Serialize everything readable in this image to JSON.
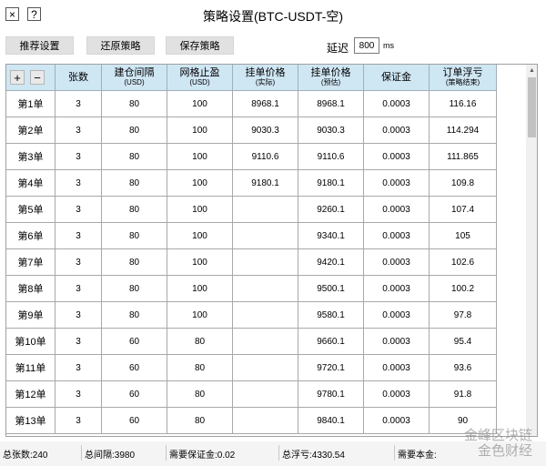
{
  "window": {
    "title": "策略设置(BTC-USDT-空)",
    "close_glyph": "×",
    "help_glyph": "?"
  },
  "toolbar": {
    "recommend_label": "推荐设置",
    "restore_label": "还原策略",
    "save_label": "保存策略",
    "delay_label": "延迟",
    "delay_value": "800",
    "delay_unit": "ms"
  },
  "grid": {
    "add_glyph": "+",
    "remove_glyph": "−",
    "columns": [
      {
        "label": "张数",
        "sub": ""
      },
      {
        "label": "建仓间隔",
        "sub": "(USD)"
      },
      {
        "label": "网格止盈",
        "sub": "(USD)"
      },
      {
        "label": "挂单价格",
        "sub": "(实际)"
      },
      {
        "label": "挂单价格",
        "sub": "(预估)"
      },
      {
        "label": "保证金",
        "sub": ""
      },
      {
        "label": "订单浮亏",
        "sub": "(策略结束)"
      }
    ],
    "rows": [
      [
        "第1单",
        "3",
        "80",
        "100",
        "8968.1",
        "8968.1",
        "0.0003",
        "116.16"
      ],
      [
        "第2单",
        "3",
        "80",
        "100",
        "9030.3",
        "9030.3",
        "0.0003",
        "114.294"
      ],
      [
        "第3单",
        "3",
        "80",
        "100",
        "9110.6",
        "9110.6",
        "0.0003",
        "111.865"
      ],
      [
        "第4单",
        "3",
        "80",
        "100",
        "9180.1",
        "9180.1",
        "0.0003",
        "109.8"
      ],
      [
        "第5单",
        "3",
        "80",
        "100",
        "",
        "9260.1",
        "0.0003",
        "107.4"
      ],
      [
        "第6单",
        "3",
        "80",
        "100",
        "",
        "9340.1",
        "0.0003",
        "105"
      ],
      [
        "第7单",
        "3",
        "80",
        "100",
        "",
        "9420.1",
        "0.0003",
        "102.6"
      ],
      [
        "第8单",
        "3",
        "80",
        "100",
        "",
        "9500.1",
        "0.0003",
        "100.2"
      ],
      [
        "第9单",
        "3",
        "80",
        "100",
        "",
        "9580.1",
        "0.0003",
        "97.8"
      ],
      [
        "第10单",
        "3",
        "60",
        "80",
        "",
        "9660.1",
        "0.0003",
        "95.4"
      ],
      [
        "第11单",
        "3",
        "60",
        "80",
        "",
        "9720.1",
        "0.0003",
        "93.6"
      ],
      [
        "第12单",
        "3",
        "60",
        "80",
        "",
        "9780.1",
        "0.0003",
        "91.8"
      ],
      [
        "第13单",
        "3",
        "60",
        "80",
        "",
        "9840.1",
        "0.0003",
        "90"
      ]
    ]
  },
  "status": {
    "total_contracts": "总张数:240",
    "total_interval": "总间隔:3980",
    "required_margin": "需要保证金:0.02",
    "total_floating": "总浮亏:4330.54",
    "required_principal": "需要本金:"
  },
  "watermark": {
    "line1": "金峰区块链",
    "line2": "金色财经"
  }
}
